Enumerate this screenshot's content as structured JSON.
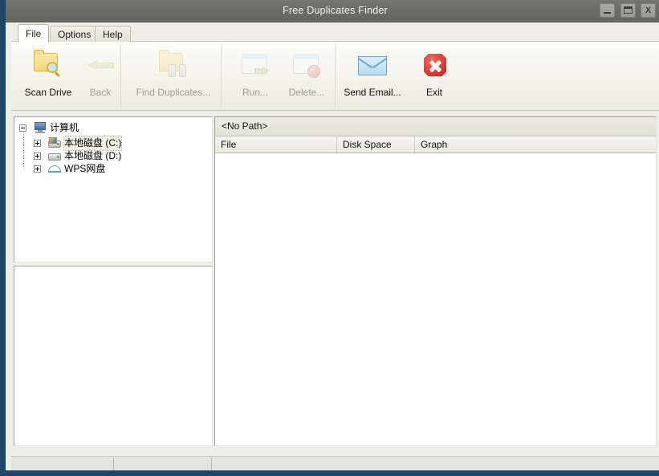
{
  "window": {
    "title": "Free Duplicates Finder",
    "controls": [
      {
        "name": "minimize",
        "glyph": "_"
      },
      {
        "name": "maximize",
        "glyph": "□"
      },
      {
        "name": "close",
        "glyph": "X"
      }
    ],
    "colors": {
      "titlebar": "#6b6d66",
      "ribbon": "#f6f5ee",
      "frame_border": "#1b4668",
      "panel_bg": "#efefe9",
      "accent_red": "#d8332a"
    }
  },
  "tabs": [
    {
      "label": "File",
      "active": true
    },
    {
      "label": "Options",
      "active": false
    },
    {
      "label": "Help",
      "active": false
    }
  ],
  "ribbon": {
    "buttons": [
      {
        "label": "Scan Drive",
        "icon": "folder-search-icon",
        "enabled": true,
        "accesskey": "S"
      },
      {
        "label": "Back",
        "icon": "arrow-left-icon",
        "enabled": false,
        "accesskey": "B"
      },
      {
        "label": "Find Duplicates...",
        "icon": "folder-binoculars-icon",
        "enabled": false,
        "accesskey": "D"
      },
      {
        "label": "Run...",
        "icon": "window-run-icon",
        "enabled": false,
        "accesskey": "R"
      },
      {
        "label": "Delete...",
        "icon": "window-delete-icon",
        "enabled": false,
        "accesskey": "D"
      },
      {
        "label": "Send Email...",
        "icon": "envelope-icon",
        "enabled": true,
        "accesskey": "a"
      },
      {
        "label": "Exit",
        "icon": "stop-x-icon",
        "enabled": true,
        "accesskey": "x"
      }
    ]
  },
  "tree": {
    "root": {
      "label": "计算机",
      "icon": "monitor-icon",
      "expander": "minus",
      "selected": false
    },
    "children": [
      {
        "label": "本地磁盘 (C:)",
        "icon": "system-drive-icon",
        "expander": "plus",
        "selected": true
      },
      {
        "label": "本地磁盘 (D:)",
        "icon": "drive-icon",
        "expander": "plus",
        "selected": false
      },
      {
        "label": "WPS网盘",
        "icon": "cloud-drive-icon",
        "expander": "plus",
        "selected": false
      }
    ]
  },
  "list": {
    "path": "<No Path>",
    "columns": [
      {
        "label": "File"
      },
      {
        "label": "Disk Space"
      },
      {
        "label": "Graph"
      }
    ],
    "rows": []
  },
  "statusbar": {
    "panes": [
      "",
      "",
      ""
    ]
  }
}
